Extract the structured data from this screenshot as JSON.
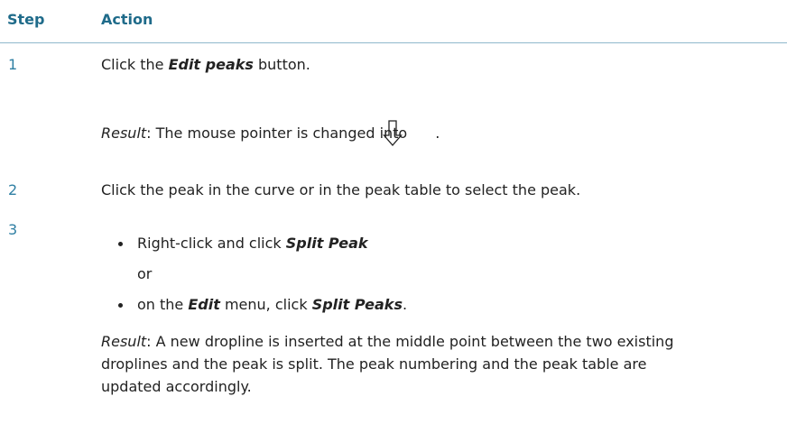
{
  "header": {
    "step": "Step",
    "action": "Action"
  },
  "rows": [
    {
      "step": "1",
      "action_pre": "Click the ",
      "action_bold": "Edit peaks",
      "action_post": " button.",
      "result_label": "Result",
      "result_text": ": The mouse pointer is changed into ",
      "result_end": ".",
      "pointer_icon": "down-arrow-pointer-icon"
    },
    {
      "step": "2",
      "action": "Click the peak in the curve or in the peak table to select the peak."
    },
    {
      "step": "3",
      "bullet1_pre": "Right-click and click ",
      "bullet1_bold": "Split Peak",
      "or": "or",
      "bullet2_pre": "on the ",
      "bullet2_bold1": "Edit",
      "bullet2_mid": " menu, click ",
      "bullet2_bold2": "Split Peaks",
      "bullet2_end": ".",
      "result_label": "Result",
      "result_lines": [
        ": A new dropline is inserted at the middle point between the two existing",
        "droplines and the peak is split. The peak numbering and the peak table are",
        "updated accordingly."
      ]
    }
  ]
}
